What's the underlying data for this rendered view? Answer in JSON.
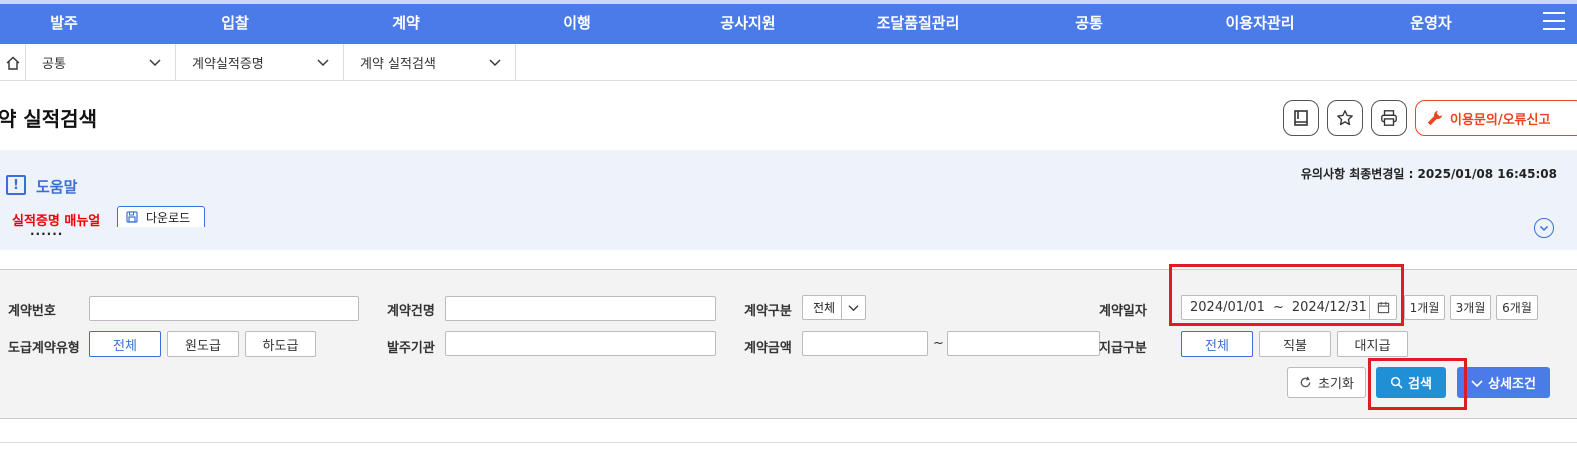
{
  "top_nav": [
    "발주",
    "입찰",
    "계약",
    "이행",
    "공사지원",
    "조달품질관리",
    "공통",
    "이용자관리",
    "운영자"
  ],
  "breadcrumb": [
    "공통",
    "계약실적증명",
    "계약 실적검색"
  ],
  "page": {
    "title": "약 실적검색",
    "report_button": "이용문의/오류신고"
  },
  "help": {
    "title": "도움말",
    "updated": "유의사항 최종변경일 : 2025/01/08 16:45:08",
    "manual_label": "실적증명 매뉴얼",
    "download_label": "다운로드",
    "ellipsis": "......"
  },
  "search": {
    "contract_no_label": "계약번호",
    "contract_name_label": "계약건명",
    "contract_type_label": "계약구분",
    "contract_type_value": "전체",
    "contract_date_label": "계약일자",
    "date_from": "2024/01/01",
    "date_sep": "~",
    "date_to": "2024/12/31",
    "period_buttons": [
      "1개월",
      "3개월",
      "6개월"
    ],
    "subcontract_type_label": "도급계약유형",
    "subcontract_types": [
      "전체",
      "원도급",
      "하도급"
    ],
    "ordering_agency_label": "발주기관",
    "contract_amount_label": "계약금액",
    "amount_tilde": "~",
    "payment_type_label": "지급구분",
    "payment_types": [
      "전체",
      "직불",
      "대지급"
    ],
    "reset_label": "초기화",
    "search_label": "검색",
    "detail_label": "상세조건"
  },
  "colors": {
    "nav_bg": "#4a7be8",
    "accent_blue": "#3a6fd8",
    "search_button": "#1f8fd6",
    "report_red": "#e8461e",
    "highlight_red": "#e01b22",
    "help_bg": "#eef3fb"
  }
}
